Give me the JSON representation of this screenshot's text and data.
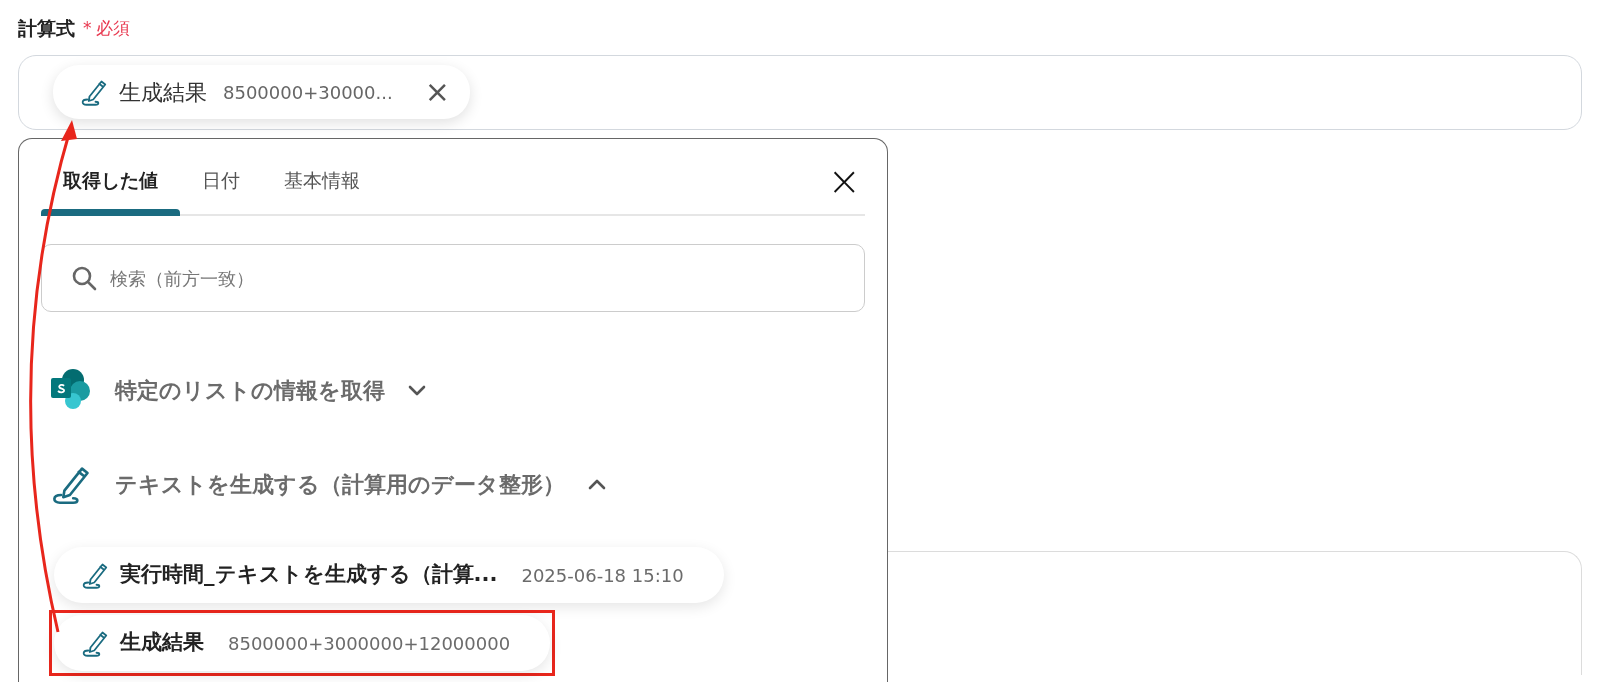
{
  "field": {
    "label": "計算式",
    "required_mark": "*",
    "required_text": "必須",
    "chip": {
      "kind": "pen",
      "name": "生成結果",
      "value": "8500000+30000...",
      "close": "×"
    }
  },
  "picker": {
    "tabs": [
      {
        "label": "取得した値",
        "selected": true
      },
      {
        "label": "日付",
        "selected": false
      },
      {
        "label": "基本情報",
        "selected": false
      }
    ],
    "close": "×",
    "search": {
      "placeholder": "検索（前方一致）"
    },
    "groups": [
      {
        "kind": "sharepoint",
        "title": "特定のリストの情報を取得",
        "expanded": false
      },
      {
        "kind": "pen",
        "title": "テキストを生成する（計算用のデータ整形）",
        "expanded": true,
        "items": [
          {
            "kind": "pen",
            "name": "実行時間_テキストを生成する（計算...",
            "value": "2025-06-18 15:10",
            "highlighted": false
          },
          {
            "kind": "pen",
            "name": "生成結果",
            "value": "8500000+3000000+12000000",
            "highlighted": true
          }
        ]
      }
    ]
  }
}
